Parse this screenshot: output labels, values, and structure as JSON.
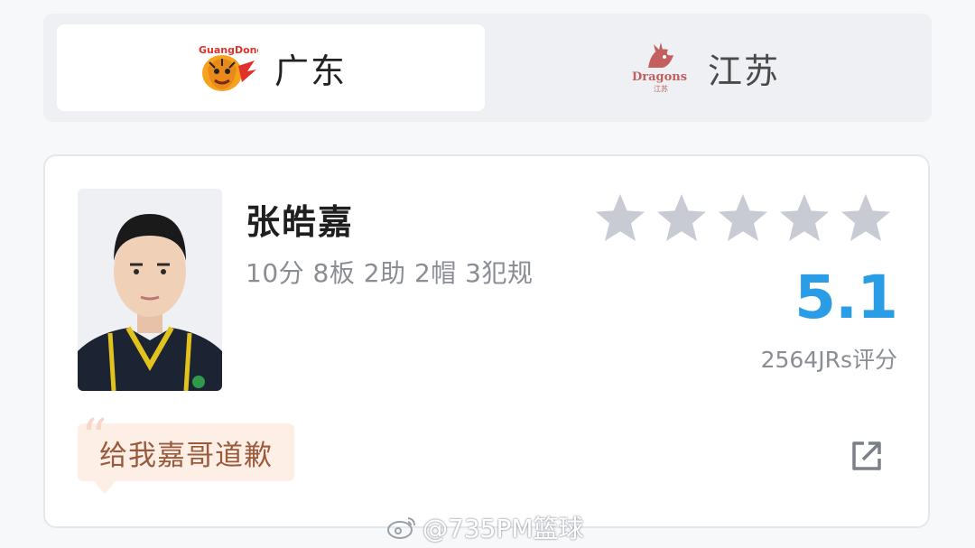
{
  "teams": {
    "home": {
      "name": "广东",
      "logo_icon": "guangdong-tigers-logo"
    },
    "away": {
      "name": "江苏",
      "logo_icon": "jiangsu-dragons-logo"
    },
    "active": "home"
  },
  "player": {
    "name": "张皓嘉",
    "stats": "10分 8板 2助 2帽 3犯规",
    "photo_icon": "player-portrait",
    "rating_stars_total": 5,
    "rating_stars_filled": 0,
    "score": "5.1",
    "raters": "2564JRs评分",
    "top_comment": "给我嘉哥道歉"
  },
  "watermark": "@735PM篮球",
  "colors": {
    "score_blue": "#2a9de6",
    "star_gray": "#c8cbd3",
    "comment_bg": "#fdeee6",
    "comment_text": "#9a5a3c"
  }
}
